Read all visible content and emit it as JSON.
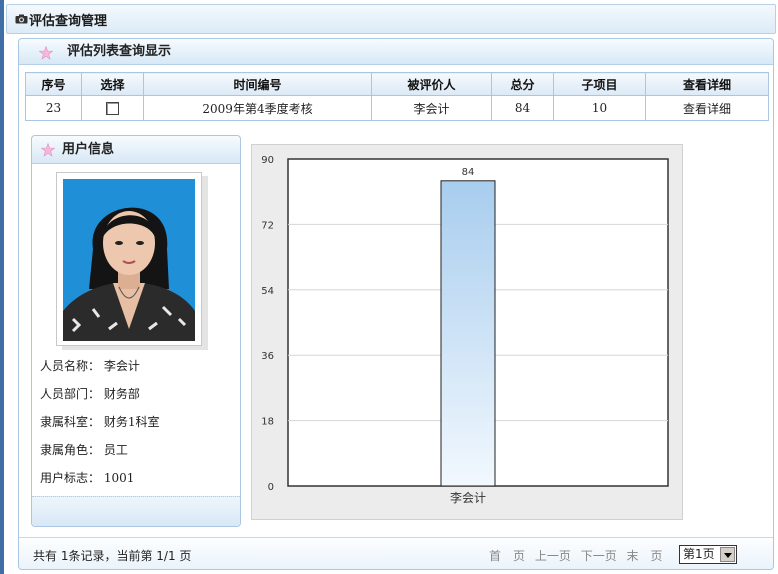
{
  "header": {
    "title": "评估查询管理"
  },
  "panel": {
    "title": "评估列表查询显示"
  },
  "table": {
    "columns": [
      "序号",
      "选择",
      "时间编号",
      "被评价人",
      "总分",
      "子项目",
      "查看详细"
    ],
    "rows": [
      {
        "index": "23",
        "period": "2009年第4季度考核",
        "person": "李会计",
        "score": "84",
        "sub_items": "10",
        "detail": "查看详细"
      }
    ]
  },
  "user_info": {
    "title": "用户信息",
    "fields": [
      {
        "label": "人员名称：",
        "value": "李会计"
      },
      {
        "label": "人员部门：",
        "value": "财务部"
      },
      {
        "label": "隶属科室：",
        "value": "财务1科室"
      },
      {
        "label": "隶属角色：",
        "value": "员工"
      },
      {
        "label": "用户标志：",
        "value": "1001"
      }
    ]
  },
  "chart_data": {
    "type": "bar",
    "categories": [
      "李会计"
    ],
    "values": [
      84
    ],
    "data_labels": [
      "84"
    ],
    "ylim": [
      0,
      90
    ],
    "yticks": [
      0,
      18,
      36,
      54,
      72,
      90
    ],
    "grid": true,
    "bar_color_top": "#a8cdee",
    "bar_color_bottom": "#f2f8fe"
  },
  "footer": {
    "record_text": "共有 1条记录，当前第 1/1 页",
    "pager": {
      "first": "首　页",
      "prev": "上一页",
      "next": "下一页",
      "last": "末　页"
    },
    "page_select": "第1页"
  }
}
